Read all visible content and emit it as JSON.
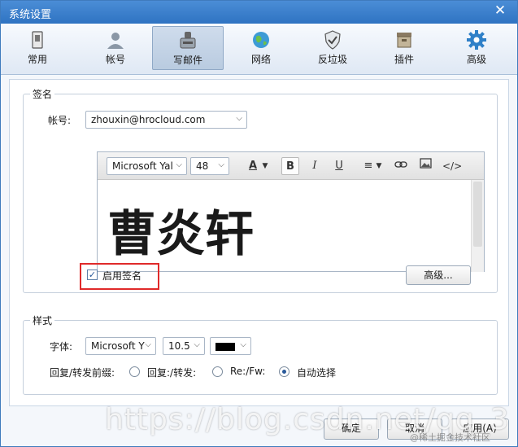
{
  "window": {
    "title": "系统设置"
  },
  "toolbar": {
    "items": [
      {
        "label": "常用",
        "icon": "general-icon"
      },
      {
        "label": "帐号",
        "icon": "account-icon"
      },
      {
        "label": "写邮件",
        "icon": "compose-mail-icon",
        "active": true
      },
      {
        "label": "网络",
        "icon": "network-globe-icon"
      },
      {
        "label": "反垃圾",
        "icon": "anti-spam-shield-icon"
      },
      {
        "label": "插件",
        "icon": "plugin-box-icon"
      },
      {
        "label": "高级",
        "icon": "gear-icon"
      }
    ]
  },
  "signature": {
    "legend": "签名",
    "account_label": "帐号:",
    "account_value": "zhouxin@hrocloud.com",
    "editor": {
      "font_family": "Microsoft Yal",
      "font_size": "48",
      "content": "曹炎轩"
    },
    "enable_label": "启用签名",
    "enabled": true,
    "advanced_button": "高级..."
  },
  "style": {
    "legend": "样式",
    "font_label": "字体:",
    "font_family": "Microsoft Y",
    "font_size": "10.5",
    "font_color": "#000000",
    "prefix_label": "回复/转发前缀:",
    "options": [
      "回复:/转发:",
      "Re:/Fw:",
      "自动选择"
    ],
    "selected_option": "自动选择"
  },
  "footer": {
    "ok": "确定",
    "cancel": "取消",
    "apply": "应用(A)"
  },
  "watermark": {
    "url": "https://blog.csdn.net/qq_3",
    "site": "@稀土掘金技术社区"
  },
  "colors": {
    "title_bar": "#2f73c2",
    "highlight": "#e02a2a"
  }
}
